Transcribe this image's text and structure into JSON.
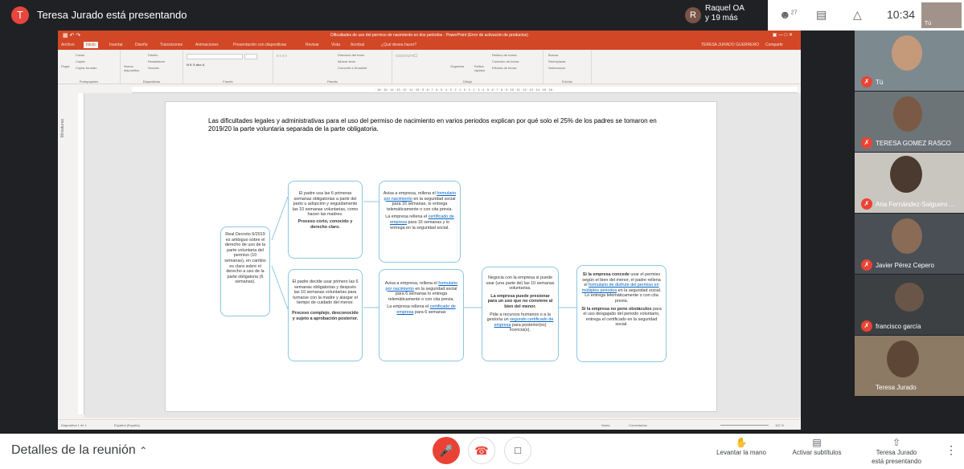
{
  "topbar": {
    "presenter_initial": "T",
    "presenter_text": "Teresa Jurado está presentando",
    "viewer_initial": "R",
    "viewer_name": "Raquel OA",
    "viewer_more": "y 19 más",
    "people_count": "27",
    "clock": "10:34",
    "self_label": "Tú"
  },
  "ppt": {
    "title": "Dificultades de uso del permiso de nacimiento en dos periodos  -  PowerPoint (Error de activación de productos)",
    "user": "TERESA JURADO GUERRERO",
    "share": "Compartir",
    "tabs": [
      "Archivo",
      "Inicio",
      "Insertar",
      "Diseño",
      "Transiciones",
      "Animaciones",
      "Presentación con diapositivas",
      "Revisar",
      "Vista",
      "Acrobat",
      "¿Qué desea hacer?"
    ],
    "groups": [
      "Portapapeles",
      "Diapositivas",
      "Fuente",
      "Párrafo",
      "Dibujo",
      "Edición"
    ],
    "ribbon_items": {
      "pegar": "Pegar",
      "cortar": "Cortar",
      "copiar": "Copiar",
      "copiar_formato": "Copiar formato",
      "nueva": "Nueva diapositiva",
      "diseno": "Diseño",
      "restablecer": "Restablecer",
      "seccion": "Sección",
      "direccion": "Dirección del texto",
      "alinear": "Alinear texto",
      "smartart": "Convertir a SmartArt",
      "organizar": "Organizar",
      "estilos": "Estilos rápidos",
      "relleno": "Relleno de forma",
      "contorno": "Contorno de forma",
      "efectos": "Efectos de forma",
      "buscar": "Buscar",
      "reemplazar": "Reemplazar",
      "seleccionar": "Seleccionar"
    },
    "thumbs_label": "Miniaturas",
    "status_slide": "Diapositiva 1 de 1",
    "status_lang": "Español (España)",
    "status_notes": "Notas",
    "status_comments": "Comentarios",
    "zoom": "112 %"
  },
  "slide": {
    "heading": "Las dificultades legales y administrativas para el uso del permiso de nacimiento en varios periodos explican por qué solo el 25% de los padres se tomaron en 2019/20 la parte voluntaria separada de la parte obligatoria.",
    "root": "Real Decreto 6/2019 es ambiguo sobre el derecho de uso de la parte voluntaria del permiso (10 semanas), en cambio es clara sobre el derecho a uso de la parte obligatoria (6 semanas).",
    "top1_text": "El padre usa  las 6 primeras semanas obligatorias a partir del parto u adopción y seguidamente las 10 semanas voluntarias, como hacen las madres.",
    "top1_bold": "Proceso corto, conocido y derecho claro.",
    "top2_a": "Avisa a empresa, rellena el",
    "top2_link1": "formulario por nacimiento",
    "top2_b": "en la seguridad social para 16 semanas, lo entrega telemáticamente o con cita previa.",
    "top2_c": "La empresa rellena el",
    "top2_link2": "certificado de empresa",
    "top2_d": "para 16 semanas y lo entrega en la seguridad social.",
    "bot1_text": "El padre decide usar primero las 6 semanas obligatorias y después las 10 semanas voluntarias para turnarse con la madre y alargar el tiempo de cuidado del menor.",
    "bot1_bold": "Proceso complejo, desconocido y sujeto a aprobación posterior.",
    "bot2_a": "Avisa a empresa, rellena el",
    "bot2_link1": "formulario por nacimiento",
    "bot2_b": "en la seguridad social para 6 semanas lo entrega telemáticamente o con cita previa.",
    "bot2_c": "La empresa rellena el",
    "bot2_link2": "certificado de empresa",
    "bot2_d": "para 6 semanas",
    "bot3_a": "Negocia con la empresa si puede usar (una parte de) las 10 semanas voluntarias.",
    "bot3_bold": "La empresa puede presionar para un uso que no conviene al bien del menor.",
    "bot3_b": "Pide a recursos humanos o a la gestoría un",
    "bot3_link": "segundo certificado de empresa",
    "bot3_c": "para posterior(es) licencia(s).",
    "bot4_bold1": "Si la empresa concede",
    "bot4_a": "usar el permiso según el bien del menor, el padre rellena el",
    "bot4_link": "formulario de disfrute del permiso en múltiples periodos",
    "bot4_b": "en la seguridad social. Lo entrega telemáticamente o con cita previa.",
    "bot4_bold2": "Si la empresa no pone obstáculos",
    "bot4_c": "para el uso desgajado del periodo voluntario, entrega el certificado en la seguridad social."
  },
  "participants": [
    {
      "name": "Tú",
      "bg": "#7c8a8f"
    },
    {
      "name": "TERESA GOMEZ RASCO",
      "bg": "#6d7478"
    },
    {
      "name": "Ana Fernández-Salguero ...",
      "bg": "#c9c6c0"
    },
    {
      "name": "Javier Pérez Cepero",
      "bg": "#4a4f55"
    },
    {
      "name": "francisco garcía",
      "bg": "#3c4043"
    },
    {
      "name": "Teresa Jurado",
      "bg": "#8c7a64"
    }
  ],
  "bottom": {
    "details": "Detalles de la reunión",
    "raise_hand": "Levantar la mano",
    "captions": "Activar subtítulos",
    "presenting_line1": "Teresa Jurado",
    "presenting_line2": "está presentando"
  }
}
